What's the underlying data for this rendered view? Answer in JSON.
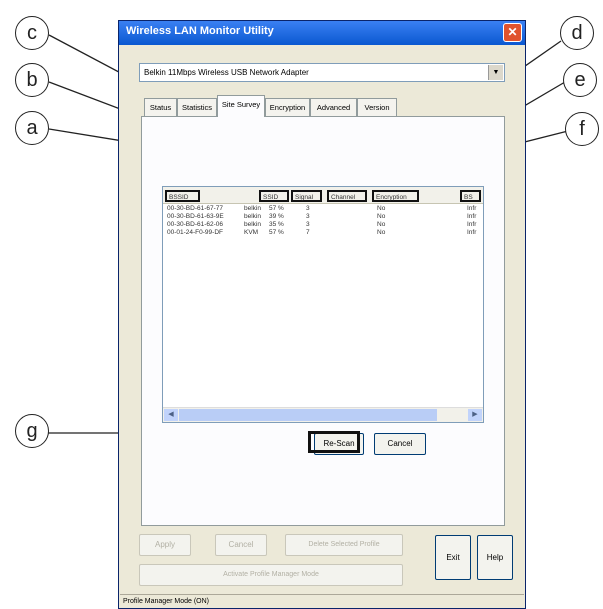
{
  "callouts": [
    "c",
    "b",
    "a",
    "g",
    "d",
    "e",
    "f"
  ],
  "window": {
    "title": "Wireless LAN Monitor Utility",
    "close_icon": "close-icon",
    "adapter": "Belkin 11Mbps Wireless USB Network Adapter",
    "tabs": [
      "Status",
      "Statistics",
      "Site Survey",
      "Encryption",
      "Advanced",
      "Version"
    ],
    "active_tab": "Site Survey",
    "columns": [
      "BSSID",
      "SSID",
      "Signal",
      "Channel",
      "Encryption",
      "BS"
    ],
    "rows": [
      [
        "00-30-BD-61-67-77",
        "belkin",
        "57 %",
        "3",
        "No",
        "Infr"
      ],
      [
        "00-30-BD-61-63-9E",
        "belkin",
        "39 %",
        "3",
        "No",
        "Infr"
      ],
      [
        "00-30-BD-61-62-06",
        "belkin",
        "35 %",
        "3",
        "No",
        "Infr"
      ],
      [
        "00-01-24-F0-99-DF",
        "KVM",
        "57 %",
        "7",
        "No",
        "Infr"
      ]
    ],
    "rescan_label": "Re-Scan",
    "cancel_label": "Cancel",
    "apply_label": "Apply",
    "cancel2_label": "Cancel",
    "delete_profile_label": "Delete Selected Profile",
    "activate_profile_label": "Activate Profile Manager Mode",
    "exit_label": "Exit",
    "help_label": "Help",
    "status": "Profile Manager Mode (ON)"
  }
}
